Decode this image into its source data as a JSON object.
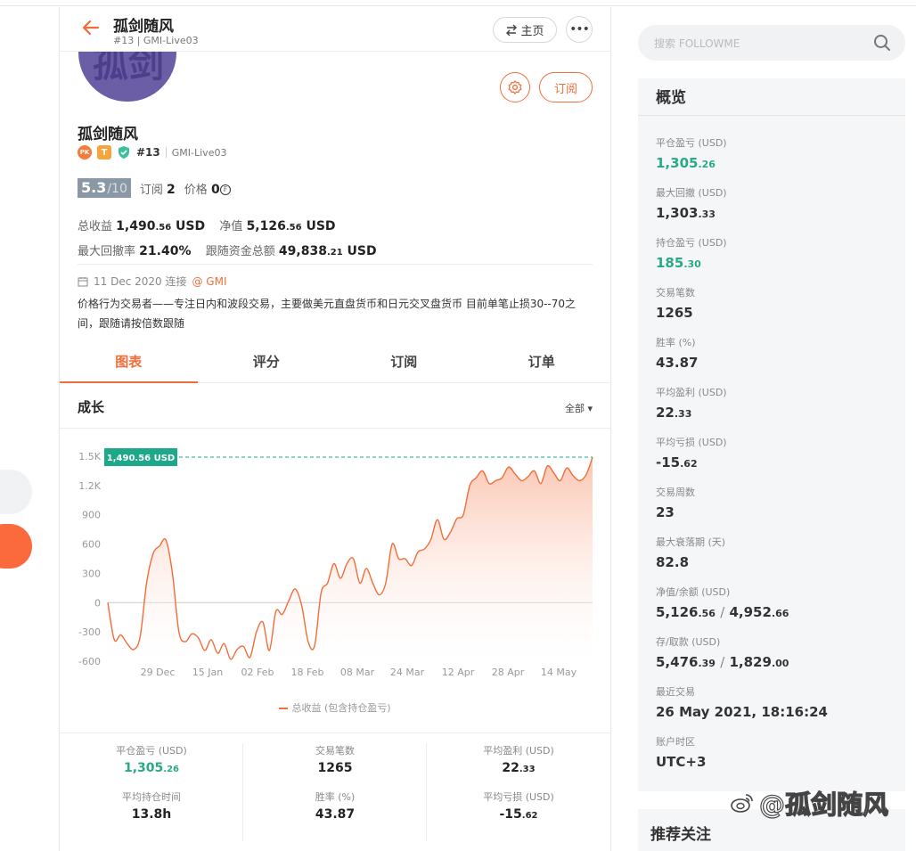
{
  "header": {
    "name": "孤剑随风",
    "subtitle": "#13 | GMI-Live03",
    "home_label": "主页",
    "more_label": "•••"
  },
  "avatar": {
    "text": "孤剑"
  },
  "actions": {
    "subscribe_label": "订阅"
  },
  "profile": {
    "name": "孤剑随风",
    "badge_pk": "PK",
    "badge_t": "T",
    "rank": "#13",
    "account": "GMI-Live03",
    "score": "5.3",
    "score_max": "/10",
    "subs_label": "订阅",
    "subs_value": "2",
    "price_label": "价格",
    "price_value": "0",
    "price_unit": "₣",
    "total_profit_label": "总收益",
    "total_profit_int": "1,490",
    "total_profit_dec": ".56",
    "total_profit_unit": "USD",
    "equity_label": "净值",
    "equity_int": "5,126",
    "equity_dec": ".56",
    "equity_unit": "USD",
    "max_dd_label": "最大回撤率",
    "max_dd_value": "21.40%",
    "follow_funds_label": "跟随资金总额",
    "follow_funds_int": "49,838",
    "follow_funds_dec": ".21",
    "follow_funds_unit": "USD",
    "joined": "11 Dec 2020 连接",
    "broker": "@ GMI",
    "description": "价格行为交易者——专注日内和波段交易，主要做美元直盘货币和日元交叉盘货币 目前单笔止损30--70之间，跟随请按倍数跟随"
  },
  "tabs": [
    {
      "label": "图表",
      "active": true
    },
    {
      "label": "评分",
      "active": false
    },
    {
      "label": "订阅",
      "active": false
    },
    {
      "label": "订单",
      "active": false
    }
  ],
  "growth": {
    "title": "成长",
    "range_label": "全部 ▾",
    "legend": "总收益 (包含持仓盈亏)",
    "current_label": "1,490.56 USD"
  },
  "chart_data": {
    "type": "area",
    "series": [
      {
        "name": "总收益 (包含持仓盈亏)",
        "values": [
          0,
          -380,
          -330,
          -420,
          -480,
          -350,
          200,
          500,
          580,
          640,
          300,
          -300,
          -400,
          -320,
          -360,
          -490,
          -380,
          -520,
          -420,
          -580,
          -480,
          -450,
          -560,
          -300,
          -200,
          -490,
          -90,
          -120,
          20,
          140,
          -30,
          -400,
          -440,
          100,
          200,
          400,
          250,
          400,
          450,
          200,
          350,
          200,
          80,
          200,
          600,
          450,
          450,
          380,
          520,
          550,
          650,
          850,
          650,
          720,
          860,
          900,
          1200,
          1280,
          1350,
          1220,
          1250,
          1280,
          1390,
          1320,
          1250,
          1290,
          1350,
          1220,
          1400,
          1330,
          1250,
          1380,
          1300,
          1250,
          1310,
          1490.56
        ]
      }
    ],
    "x_ticks": [
      "29 Dec",
      "15 Jan",
      "02 Feb",
      "18 Feb",
      "08 Mar",
      "24 Mar",
      "12 Apr",
      "28 Apr",
      "14 May"
    ],
    "y_ticks": [
      "1.5K",
      "1.2K",
      "900",
      "600",
      "300",
      "0",
      "-300",
      "-600"
    ],
    "ylim": [
      -600,
      1500
    ],
    "colors": {
      "line": "#f16d3b",
      "fill": "#fbc2ad",
      "label_bg": "#1ea88a",
      "dash": "#1ea88a"
    }
  },
  "bottom_stats": [
    {
      "label": "平仓盈亏 (USD)",
      "int": "1,305",
      "dec": ".26",
      "green": true
    },
    {
      "label": "交易笔数",
      "int": "1265",
      "dec": "",
      "green": false
    },
    {
      "label": "平均盈利 (USD)",
      "int": "22",
      "dec": ".33",
      "green": false
    },
    {
      "label": "平均持仓时间",
      "int": "13.8h",
      "dec": "",
      "green": false
    },
    {
      "label": "胜率 (%)",
      "int": "43.87",
      "dec": "",
      "green": false
    },
    {
      "label": "平均亏损 (USD)",
      "int": "-15",
      "dec": ".62",
      "green": false
    }
  ],
  "search": {
    "placeholder": "搜索 FOLLOWME"
  },
  "overview": {
    "title": "概览",
    "items": [
      {
        "label": "平仓盈亏 (USD)",
        "value": "1,305",
        "dec": ".26",
        "green": true
      },
      {
        "label": "最大回撤 (USD)",
        "value": "1,303",
        "dec": ".33",
        "green": false
      },
      {
        "label": "持仓盈亏 (USD)",
        "value": "185",
        "dec": ".30",
        "green": true
      },
      {
        "label": "交易笔数",
        "value": "1265",
        "dec": "",
        "green": false
      },
      {
        "label": "胜率 (%)",
        "value": "43.87",
        "dec": "",
        "green": false
      },
      {
        "label": "平均盈利 (USD)",
        "value": "22",
        "dec": ".33",
        "green": false
      },
      {
        "label": "平均亏损 (USD)",
        "value": "-15",
        "dec": ".62",
        "green": false
      },
      {
        "label": "交易周数",
        "value": "23",
        "dec": "",
        "green": false
      },
      {
        "label": "最大衰落期 (天)",
        "value": "82.8",
        "dec": "",
        "green": false
      },
      {
        "label": "净值/余额 (USD)",
        "value": "5,126",
        "dec": ".56",
        "value2": "4,952",
        "dec2": ".66",
        "green": false
      },
      {
        "label": "存/取款 (USD)",
        "value": "5,476",
        "dec": ".39",
        "value2": "1,829",
        "dec2": ".00",
        "green": false
      },
      {
        "label": "最近交易",
        "value": "26 May 2021, 18:16:24",
        "dec": "",
        "green": false
      },
      {
        "label": "账户时区",
        "value": "UTC+3",
        "dec": "",
        "green": false
      }
    ]
  },
  "recommend": {
    "title": "推荐关注"
  },
  "watermark": {
    "text": "@孤剑随风"
  }
}
